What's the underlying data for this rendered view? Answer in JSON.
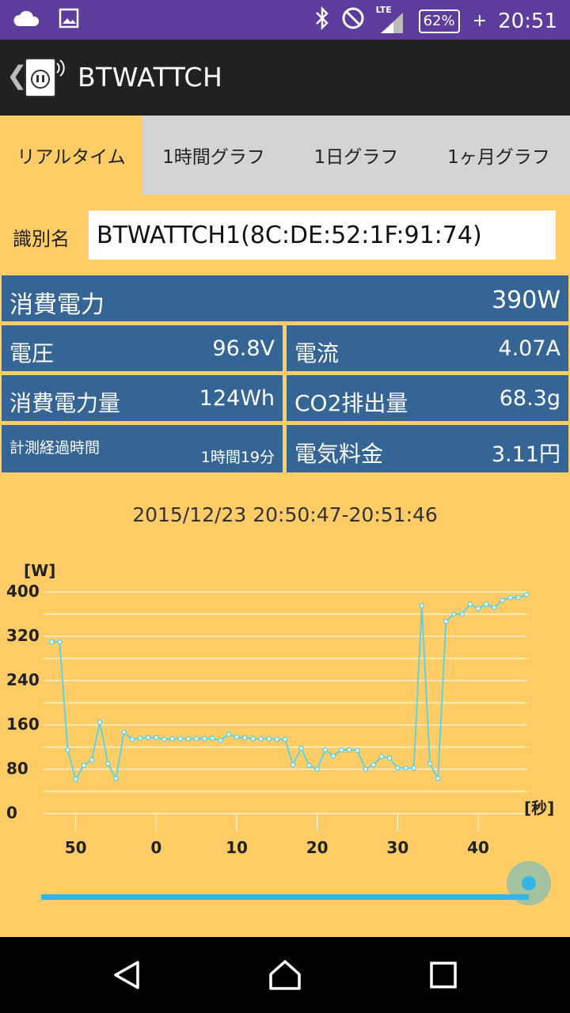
{
  "status_bar": {
    "icons_left": [
      "cloud-icon",
      "image-icon"
    ],
    "icons_right": [
      "bluetooth-icon",
      "do-not-disturb-icon",
      "lte-signal-icon"
    ],
    "network": "LTE",
    "battery": "62%",
    "time": "20:51"
  },
  "app_bar": {
    "title": "BTWATTCH",
    "icon": "smart-plug-icon"
  },
  "tabs": [
    {
      "label": "リアルタイム",
      "active": true
    },
    {
      "label": "1時間グラフ",
      "active": false
    },
    {
      "label": "1日グラフ",
      "active": false
    },
    {
      "label": "1ヶ月グラフ",
      "active": false
    }
  ],
  "device": {
    "label": "識別名",
    "value": "BTWATTCH1(8C:DE:52:1F:91:74)"
  },
  "metrics": {
    "power": {
      "label": "消費電力",
      "value": "390W"
    },
    "voltage": {
      "label": "電圧",
      "value": "96.8V"
    },
    "current": {
      "label": "電流",
      "value": "4.07A"
    },
    "energy": {
      "label": "消費電力量",
      "value": "124Wh"
    },
    "co2": {
      "label": "CO2排出量",
      "value": "68.3g"
    },
    "elapsed": {
      "label": "計測経過時間",
      "value": "1時間19分"
    },
    "cost": {
      "label": "電気料金",
      "value": "3.11円"
    }
  },
  "time_range": "2015/12/23 20:50:47-20:51:46",
  "colors": {
    "cell_bg": "#356595",
    "page_bg": "#FFCC66",
    "line": "#5FD3E0",
    "accent": "#33B5E5"
  },
  "chart_data": {
    "type": "line",
    "ylabel": "[W]",
    "xlabel": "[秒]",
    "ylim": [
      0,
      400
    ],
    "yticks": [
      0,
      80,
      160,
      240,
      320,
      400
    ],
    "xticks": [
      {
        "label": "50",
        "x": 50
      },
      {
        "label": "0",
        "x": 60
      },
      {
        "label": "10",
        "x": 70
      },
      {
        "label": "20",
        "x": 80
      },
      {
        "label": "30",
        "x": 90
      },
      {
        "label": "40",
        "x": 100
      }
    ],
    "xlim": [
      46,
      106
    ],
    "grid": true,
    "series": [
      {
        "x": [
          47,
          48,
          49,
          50,
          51,
          52,
          53,
          54,
          55,
          56,
          57,
          58,
          59,
          60,
          61,
          62,
          63,
          64,
          65,
          66,
          67,
          68,
          69,
          70,
          71,
          72,
          73,
          74,
          75,
          76,
          77,
          78,
          79,
          80,
          81,
          82,
          83,
          84,
          85,
          86,
          87,
          88,
          89,
          90,
          91,
          92,
          93,
          94,
          95,
          96,
          97,
          98,
          99,
          100,
          101,
          102,
          103,
          104,
          105,
          106
        ],
        "values": [
          310,
          310,
          115,
          62,
          87,
          97,
          165,
          90,
          63,
          147,
          134,
          136,
          137,
          137,
          134,
          135,
          135,
          135,
          135,
          135,
          136,
          132,
          143,
          138,
          137,
          135,
          135,
          135,
          134,
          134,
          88,
          118,
          87,
          80,
          115,
          104,
          115,
          115,
          114,
          80,
          88,
          103,
          100,
          82,
          82,
          82,
          375,
          90,
          63,
          347,
          360,
          360,
          378,
          370,
          378,
          372,
          385,
          390,
          390,
          395
        ]
      }
    ]
  }
}
